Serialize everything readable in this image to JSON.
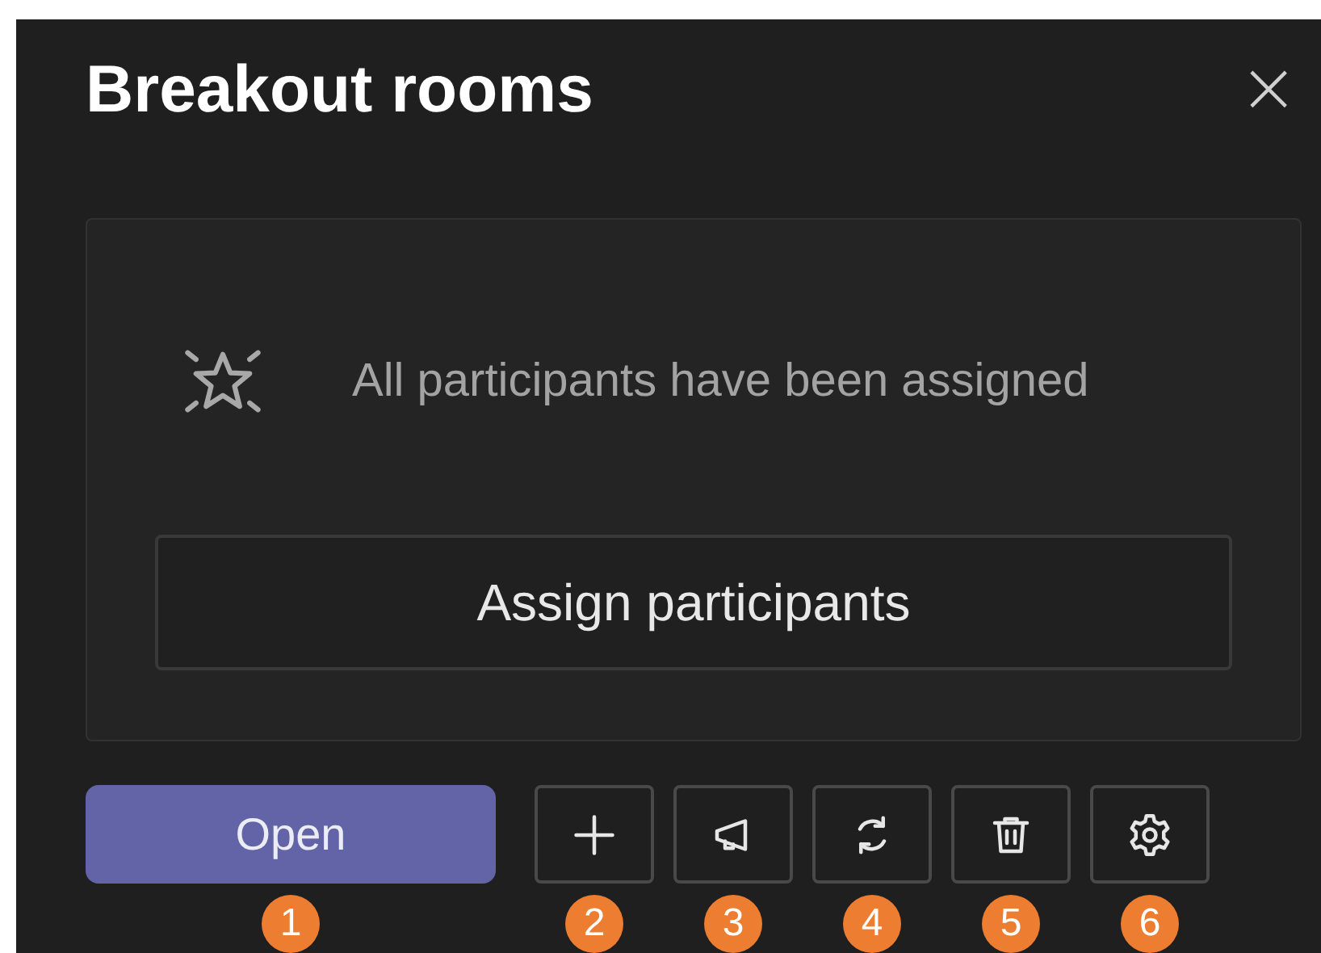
{
  "panel": {
    "title": "Breakout rooms",
    "close": "×"
  },
  "status": {
    "message": "All participants have been assigned",
    "action": "Assign participants"
  },
  "actions": [
    {
      "kind": "open",
      "label": "Open",
      "callout": "1"
    },
    {
      "kind": "add",
      "callout": "2"
    },
    {
      "kind": "announce",
      "callout": "3"
    },
    {
      "kind": "recreate",
      "callout": "4"
    },
    {
      "kind": "delete",
      "callout": "5"
    },
    {
      "kind": "settings",
      "callout": "6"
    }
  ]
}
